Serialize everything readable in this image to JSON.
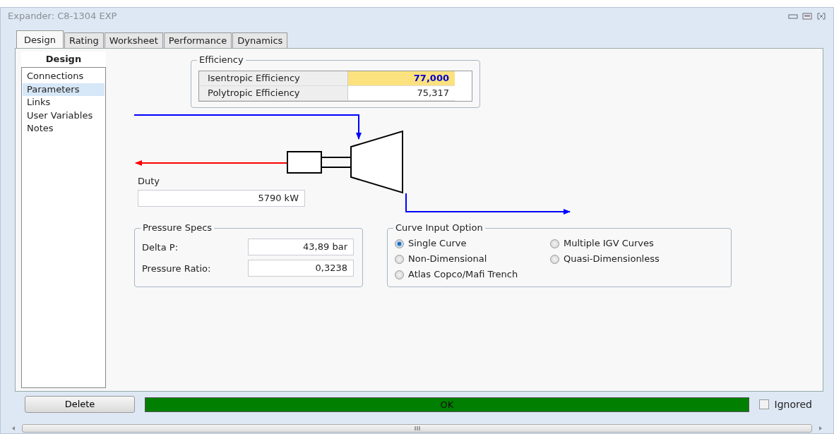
{
  "window": {
    "title": "Expander: C8-1304 EXP"
  },
  "tabs": [
    {
      "label": "Design",
      "selected": true
    },
    {
      "label": "Rating",
      "selected": false
    },
    {
      "label": "Worksheet",
      "selected": false
    },
    {
      "label": "Performance",
      "selected": false
    },
    {
      "label": "Dynamics",
      "selected": false
    }
  ],
  "sidebar": {
    "header": "Design",
    "items": [
      {
        "label": "Connections",
        "selected": false
      },
      {
        "label": "Parameters",
        "selected": true
      },
      {
        "label": "Links",
        "selected": false
      },
      {
        "label": "User Variables",
        "selected": false
      },
      {
        "label": "Notes",
        "selected": false
      }
    ]
  },
  "efficiency": {
    "title": "Efficiency",
    "rows": [
      {
        "label": "Isentropic Efficiency",
        "value": "77,000",
        "kind": "specified"
      },
      {
        "label": "Polytropic Efficiency",
        "value": "75,317",
        "kind": "calculated"
      }
    ]
  },
  "duty": {
    "label": "Duty",
    "value": "5790 kW"
  },
  "pressure_specs": {
    "title": "Pressure Specs",
    "rows": [
      {
        "label": "Delta P:",
        "value": "43,89 bar"
      },
      {
        "label": "Pressure Ratio:",
        "value": "0,3238"
      }
    ]
  },
  "curve_input_option": {
    "title": "Curve Input Option",
    "options": [
      {
        "label": "Single Curve",
        "selected": true
      },
      {
        "label": "Multiple IGV Curves",
        "selected": false
      },
      {
        "label": "Non-Dimensional",
        "selected": false
      },
      {
        "label": "Quasi-Dimensionless",
        "selected": false
      },
      {
        "label": "Atlas Copco/Mafi Trench",
        "selected": false
      }
    ]
  },
  "footer": {
    "delete_button": "Delete",
    "status": "OK",
    "ignored": {
      "label": "Ignored",
      "checked": false
    }
  }
}
